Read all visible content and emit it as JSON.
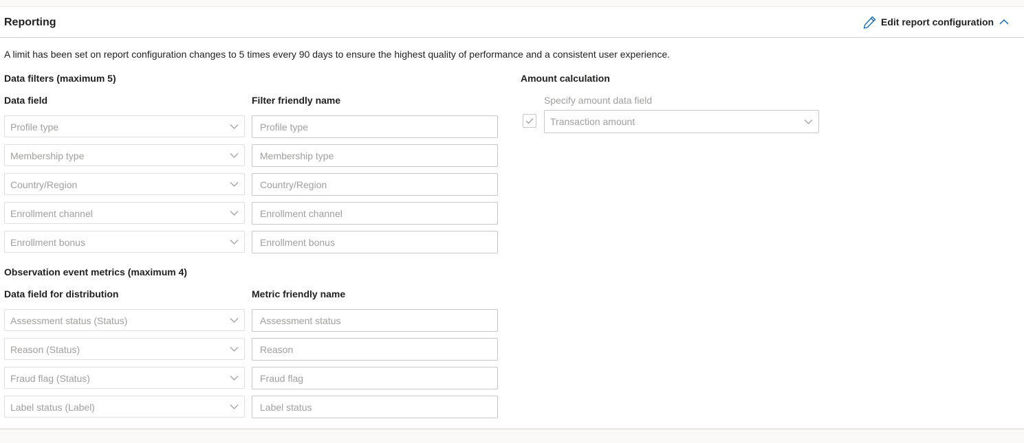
{
  "header": {
    "title": "Reporting",
    "edit_label": "Edit report configuration"
  },
  "notice": "A limit has been set on report configuration changes to 5 times every 90 days to ensure the highest quality of performance and a consistent user experience.",
  "data_filters": {
    "heading": "Data filters (maximum 5)",
    "col_field": "Data field",
    "col_name": "Filter friendly name",
    "rows": [
      {
        "field": "Profile type",
        "name": "Profile type"
      },
      {
        "field": "Membership type",
        "name": "Membership type"
      },
      {
        "field": "Country/Region",
        "name": "Country/Region"
      },
      {
        "field": "Enrollment channel",
        "name": "Enrollment channel"
      },
      {
        "field": "Enrollment bonus",
        "name": "Enrollment bonus"
      }
    ]
  },
  "metrics": {
    "heading": "Observation event metrics (maximum 4)",
    "col_field": "Data field for distribution",
    "col_name": "Metric friendly name",
    "rows": [
      {
        "field": "Assessment status (Status)",
        "name": "Assessment status"
      },
      {
        "field": "Reason (Status)",
        "name": "Reason"
      },
      {
        "field": "Fraud flag (Status)",
        "name": "Fraud flag"
      },
      {
        "field": "Label status (Label)",
        "name": "Label status"
      }
    ]
  },
  "amount": {
    "heading": "Amount calculation",
    "field_label": "Specify amount data field",
    "value": "Transaction amount",
    "checked": true
  },
  "colors": {
    "accent": "#0f6cbd",
    "disabled_text": "#a19f9d",
    "border": "#c8c6c4"
  }
}
